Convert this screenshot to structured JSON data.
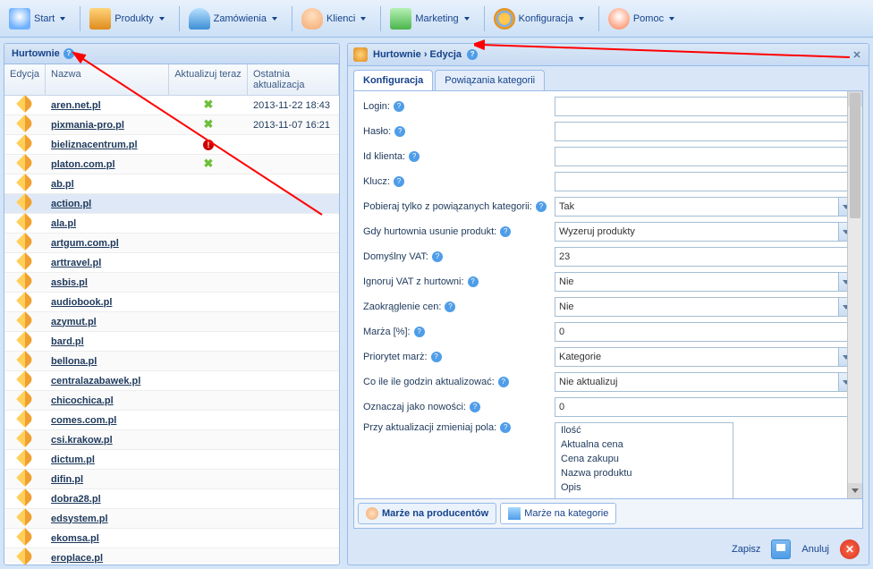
{
  "toolbar": {
    "start": "Start",
    "products": "Produkty",
    "orders": "Zamówienia",
    "clients": "Klienci",
    "marketing": "Marketing",
    "config": "Konfiguracja",
    "help": "Pomoc"
  },
  "left_panel": {
    "title": "Hurtownie",
    "columns": {
      "edit": "Edycja",
      "name": "Nazwa",
      "update": "Aktualizuj teraz",
      "last": "Ostatnia aktualizacja"
    },
    "rows": [
      {
        "name": "aren.net.pl",
        "update": "ok",
        "date": "2013-11-22 18:43"
      },
      {
        "name": "pixmania-pro.pl",
        "update": "ok",
        "date": "2013-11-07 16:21"
      },
      {
        "name": "bieliznacentrum.pl",
        "update": "err",
        "date": ""
      },
      {
        "name": "platon.com.pl",
        "update": "ok",
        "date": ""
      },
      {
        "name": "ab.pl",
        "update": "",
        "date": ""
      },
      {
        "name": "action.pl",
        "update": "",
        "date": "",
        "selected": true
      },
      {
        "name": "ala.pl",
        "update": "",
        "date": ""
      },
      {
        "name": "artgum.com.pl",
        "update": "",
        "date": ""
      },
      {
        "name": "arttravel.pl",
        "update": "",
        "date": ""
      },
      {
        "name": "asbis.pl",
        "update": "",
        "date": ""
      },
      {
        "name": "audiobook.pl",
        "update": "",
        "date": ""
      },
      {
        "name": "azymut.pl",
        "update": "",
        "date": ""
      },
      {
        "name": "bard.pl",
        "update": "",
        "date": ""
      },
      {
        "name": "bellona.pl",
        "update": "",
        "date": ""
      },
      {
        "name": "centralazabawek.pl",
        "update": "",
        "date": ""
      },
      {
        "name": "chicochica.pl",
        "update": "",
        "date": ""
      },
      {
        "name": "comes.com.pl",
        "update": "",
        "date": ""
      },
      {
        "name": "csi.krakow.pl",
        "update": "",
        "date": ""
      },
      {
        "name": "dictum.pl",
        "update": "",
        "date": ""
      },
      {
        "name": "difin.pl",
        "update": "",
        "date": ""
      },
      {
        "name": "dobra28.pl",
        "update": "",
        "date": ""
      },
      {
        "name": "edsystem.pl",
        "update": "",
        "date": ""
      },
      {
        "name": "ekomsa.pl",
        "update": "",
        "date": ""
      },
      {
        "name": "eroplace.pl",
        "update": "",
        "date": ""
      }
    ]
  },
  "right_panel": {
    "title": "Hurtownie › Edycja",
    "tabs": {
      "config": "Konfiguracja",
      "cat": "Powiązania kategorii"
    },
    "form": {
      "login_lbl": "Login:",
      "login_val": "",
      "haslo_lbl": "Hasło:",
      "haslo_val": "",
      "idk_lbl": "Id klienta:",
      "idk_val": "",
      "klucz_lbl": "Klucz:",
      "klucz_val": "",
      "pob_lbl": "Pobieraj tylko z powiązanych kategorii:",
      "pob_val": "Tak",
      "usun_lbl": "Gdy hurtownia usunie produkt:",
      "usun_val": "Wyzeruj produkty",
      "vat_lbl": "Domyślny VAT:",
      "vat_val": "23",
      "ignvat_lbl": "Ignoruj VAT z hurtowni:",
      "ignvat_val": "Nie",
      "zaokr_lbl": "Zaokrąglenie cen:",
      "zaokr_val": "Nie",
      "marza_lbl": "Marża [%]:",
      "marza_val": "0",
      "prio_lbl": "Priorytet marż:",
      "prio_val": "Kategorie",
      "godz_lbl": "Co ile ile godzin aktualizować:",
      "godz_val": "Nie aktualizuj",
      "nowosci_lbl": "Oznaczaj jako nowości:",
      "nowosci_val": "0",
      "zmien_lbl": "Przy aktualizacji zmieniaj pola:",
      "zmien_opts": [
        "Ilość",
        "Aktualna cena",
        "Cena zakupu",
        "Nazwa produktu",
        "Opis"
      ]
    },
    "subtabs": {
      "prod": "Marże na producentów",
      "cat": "Marże na kategorie"
    },
    "footer": {
      "save": "Zapisz",
      "cancel": "Anuluj"
    }
  }
}
